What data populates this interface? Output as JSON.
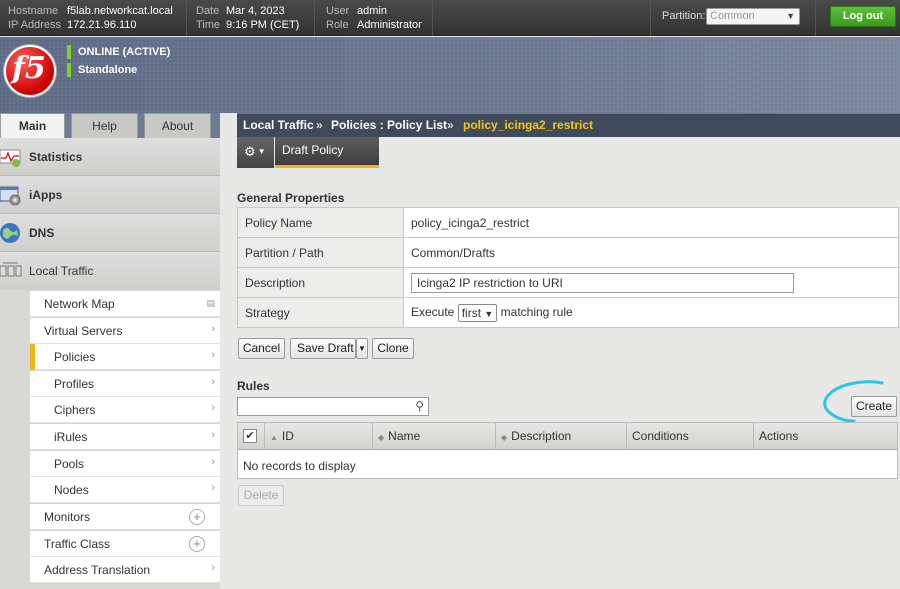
{
  "topbar": {
    "hostname_label": "Hostname",
    "hostname": "f5lab.networkcat.local",
    "ip_label": "IP Address",
    "ip": "172.21.96.110",
    "date_label": "Date",
    "date": "Mar 4, 2023",
    "time_label": "Time",
    "time": "9:16 PM (CET)",
    "user_label": "User",
    "user": "admin",
    "role_label": "Role",
    "role": "Administrator",
    "partition_label": "Partition:",
    "partition_value": "Common",
    "logout_label": "Log out"
  },
  "header": {
    "logo_text": "f5",
    "status_line1": "ONLINE (ACTIVE)",
    "status_line2": "Standalone",
    "status_color": "#7ed321"
  },
  "nav_tabs": [
    "Main",
    "Help",
    "About"
  ],
  "sidebar": {
    "sections": [
      {
        "label": "Statistics",
        "icon": "statistics-chart-icon"
      },
      {
        "label": "iApps",
        "icon": "iapps-gear-icon"
      },
      {
        "label": "DNS",
        "icon": "globe-icon"
      },
      {
        "label": "Local Traffic",
        "icon": "local-traffic-icon"
      }
    ],
    "items": [
      {
        "label": "Network Map",
        "suffix": "map-icon"
      },
      {
        "label": "Virtual Servers",
        "suffix": "chevron"
      },
      {
        "label": "Policies",
        "suffix": "chevron",
        "active": true
      },
      {
        "label": "Profiles",
        "suffix": "chevron"
      },
      {
        "label": "Ciphers",
        "suffix": "chevron"
      },
      {
        "label": "iRules",
        "suffix": "chevron"
      },
      {
        "label": "Pools",
        "suffix": "chevron"
      },
      {
        "label": "Nodes",
        "suffix": "chevron"
      },
      {
        "label": "Monitors",
        "suffix": "plus"
      },
      {
        "label": "Traffic Class",
        "suffix": "plus"
      },
      {
        "label": "Address Translation",
        "suffix": "chevron"
      }
    ]
  },
  "breadcrumb": {
    "part1": "Local Traffic",
    "sep1": "»",
    "part2": "Policies : Policy List",
    "sep2": "»",
    "current": "policy_icinga2_restrict"
  },
  "tabs": {
    "active": "Draft Policy"
  },
  "general": {
    "title": "General Properties",
    "rows": {
      "policy_name_label": "Policy Name",
      "policy_name": "policy_icinga2_restrict",
      "partition_label": "Partition / Path",
      "partition": "Common/Drafts",
      "description_label": "Description",
      "description": "Icinga2 IP restriction to URI",
      "strategy_label": "Strategy",
      "strategy_prefix": "Execute",
      "strategy_select": "first",
      "strategy_suffix": "matching rule"
    }
  },
  "buttons": {
    "cancel": "Cancel",
    "save_draft": "Save Draft",
    "clone": "Clone",
    "create": "Create",
    "delete": "Delete"
  },
  "rules": {
    "title": "Rules",
    "columns": [
      "ID",
      "Name",
      "Description",
      "Conditions",
      "Actions"
    ],
    "empty": "No records to display"
  },
  "colors": {
    "accent": "#f0b51a",
    "logout_green": "#4caf26",
    "annotation": "#29c6e8"
  }
}
